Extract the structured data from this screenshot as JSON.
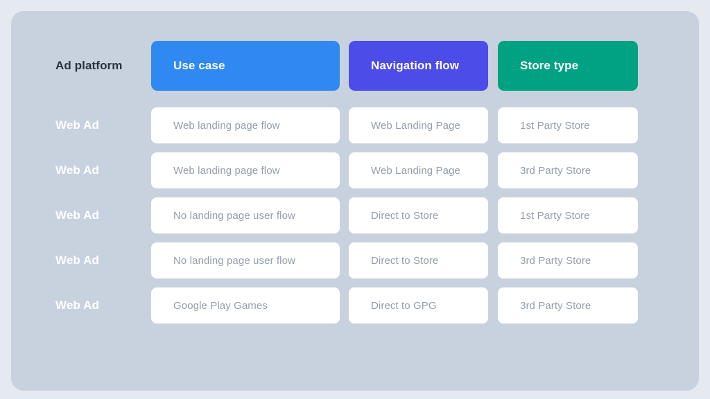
{
  "card": {
    "background_color": "#c8d2de",
    "page_background_color": "#e5e9f0"
  },
  "matrix": {
    "corner_label": "Ad platform",
    "headers": [
      {
        "label": "Use case",
        "color": "#3089f0"
      },
      {
        "label": "Navigation flow",
        "color": "#4c4ce8"
      },
      {
        "label": "Store type",
        "color": "#01a183"
      }
    ],
    "rows": [
      {
        "platform": "Web Ad",
        "use_case": "Web landing page flow",
        "navigation_flow": "Web Landing Page",
        "store_type": "1st Party Store"
      },
      {
        "platform": "Web Ad",
        "use_case": "Web landing page flow",
        "navigation_flow": "Web Landing Page",
        "store_type": "3rd Party Store"
      },
      {
        "platform": "Web Ad",
        "use_case": "No landing page user flow",
        "navigation_flow": "Direct to Store",
        "store_type": "1st Party Store"
      },
      {
        "platform": "Web Ad",
        "use_case": "No landing page user flow",
        "navigation_flow": "Direct to Store",
        "store_type": "3rd Party Store"
      },
      {
        "platform": "Web Ad",
        "use_case": "Google Play Games",
        "navigation_flow": "Direct to GPG",
        "store_type": "3rd Party Store"
      }
    ]
  }
}
